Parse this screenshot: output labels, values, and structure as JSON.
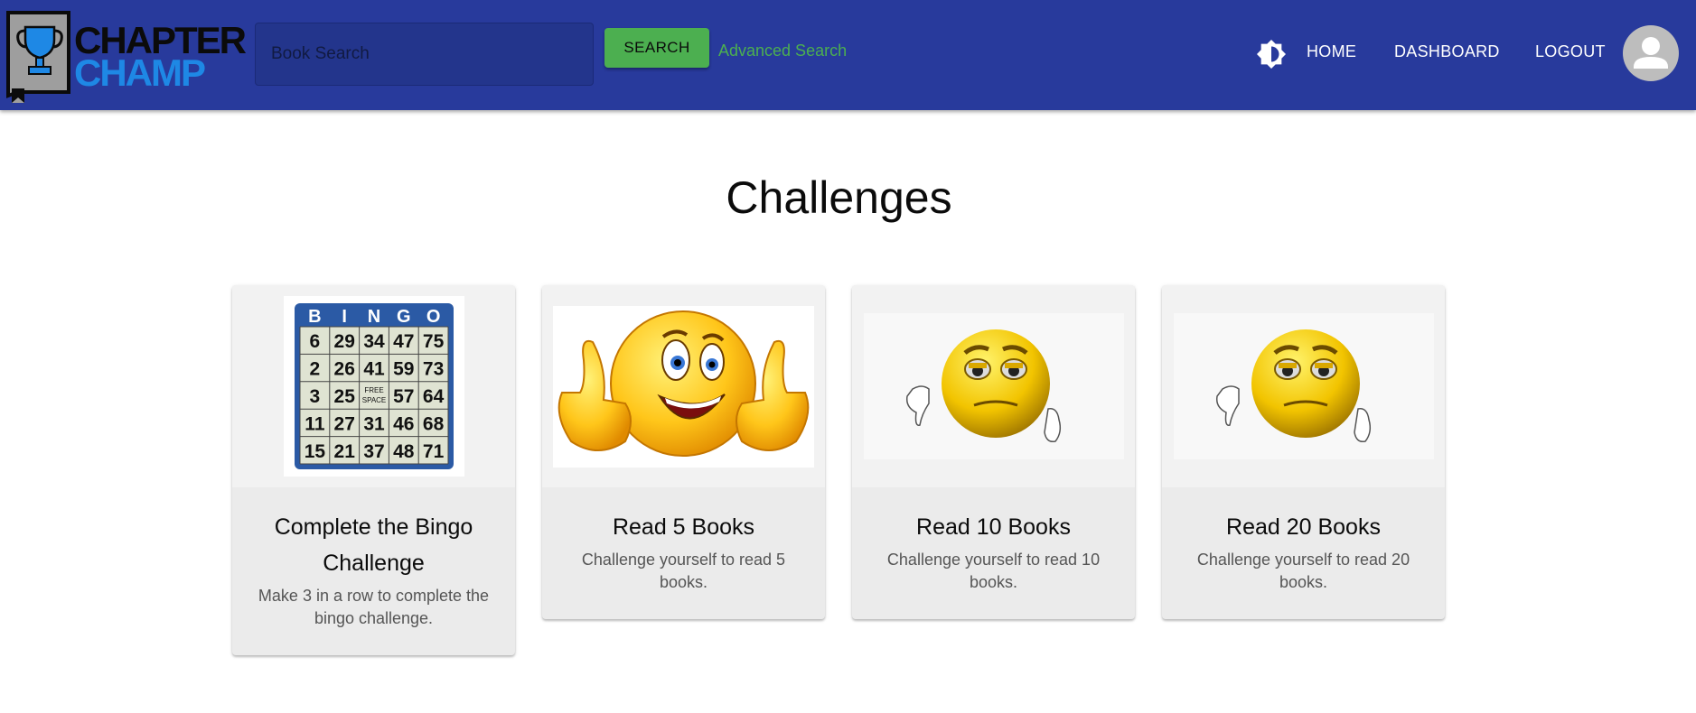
{
  "header": {
    "logo": {
      "line1": "CHAPTER",
      "line2": "CHAMP"
    },
    "search": {
      "placeholder": "Book Search",
      "value": ""
    },
    "search_button_label": "SEARCH",
    "advanced_search_label": "Advanced Search",
    "nav": [
      {
        "label": "HOME"
      },
      {
        "label": "DASHBOARD"
      },
      {
        "label": "LOGOUT"
      }
    ],
    "icons": {
      "theme": "brightness-icon",
      "avatar": "person-icon"
    }
  },
  "main": {
    "title": "Challenges",
    "cards": [
      {
        "title": "Complete the Bingo Challenge",
        "description": "Make 3 in a row to complete the bingo challenge.",
        "image": "bingo-card-image"
      },
      {
        "title": "Read 5 Books",
        "description": "Challenge yourself to read 5 books.",
        "image": "thumbs-up-smiley-image"
      },
      {
        "title": "Read 10 Books",
        "description": "Challenge yourself to read 10 books.",
        "image": "thumbs-down-sad-face-image"
      },
      {
        "title": "Read 20 Books",
        "description": "Challenge yourself to read 20 books.",
        "image": "thumbs-down-sad-face-image"
      }
    ],
    "bingo": {
      "letters": [
        "B",
        "I",
        "N",
        "G",
        "O"
      ],
      "rows": [
        [
          "6",
          "29",
          "34",
          "47",
          "75"
        ],
        [
          "2",
          "26",
          "41",
          "59",
          "73"
        ],
        [
          "3",
          "25",
          "FREE SPACE",
          "57",
          "64"
        ],
        [
          "11",
          "27",
          "31",
          "46",
          "68"
        ],
        [
          "15",
          "21",
          "37",
          "48",
          "71"
        ]
      ]
    }
  },
  "colors": {
    "appbar": "#283a9c",
    "accent_green": "#4caf50",
    "logo_blue": "#1e88e5",
    "card_bg": "#ebebeb"
  }
}
